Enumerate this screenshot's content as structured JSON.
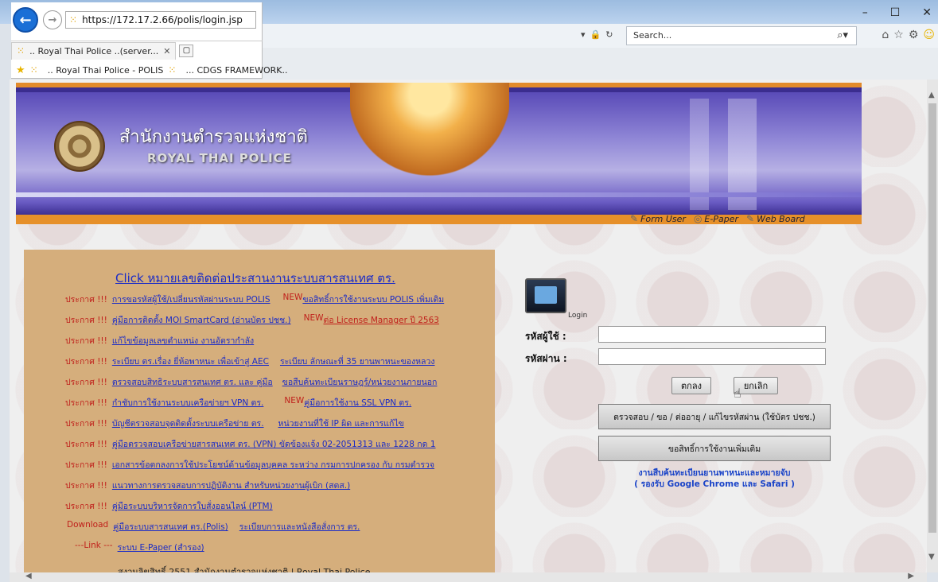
{
  "browser": {
    "search_placeholder": "Search...",
    "window_controls": [
      "–",
      "☐",
      "✕"
    ],
    "url": "https://172.17.2.66/polis/login.jsp",
    "tab_title": ".. Royal Thai Police ..(server...",
    "favorites": [
      ".. Royal Thai Police - POLIS",
      "... CDGS FRAMEWORK.."
    ]
  },
  "banner": {
    "title_th": "สำนักงานตำรวจแห่งชาติ",
    "title_en": "ROYAL THAI POLICE",
    "links": [
      "Form User",
      "E-Paper",
      "Web Board"
    ]
  },
  "announce": {
    "heading": "Click หมายเลขติดต่อประสานงานระบบสารสนเทศ ตร.",
    "rows": [
      {
        "pre": "ประกาศ !!!",
        "link": "การขอรหัสผู้ใช้/เปลี่ยนรหัสผ่านระบบ POLIS",
        "new": "NEW",
        "link2": "ขอสิทธิ์การใช้งานระบบ POLIS เพิ่มเติม"
      },
      {
        "pre": "ประกาศ !!!",
        "link": "คู่มือการติดตั้ง MOI SmartCard (อ่านบัตร ปชช.)",
        "new": "NEW",
        "link2": "ต่อ License Manager ปี 2563"
      },
      {
        "pre": "ประกาศ !!!",
        "link": "แก้ไขข้อมูลเลขตำแหน่ง งานอัตรากำลัง",
        "new": "",
        "link2": ""
      },
      {
        "pre": "ประกาศ !!!",
        "link": "ระเบียบ ตร.เรื่อง ยี่ห้อพาหนะ เพื่อเข้าสู่ AEC",
        "new": "",
        "link2": "ระเบียบ ลักษณะที่ 35 ยานพาหนะของหลวง"
      },
      {
        "pre": "ประกาศ !!!",
        "link": "ตรวจสอบสิทธิระบบสารสนเทศ ตร. และ คู่มือ",
        "new": "",
        "link2": "ขอสืบค้นทะเบียนราษฎร์/หน่วยงานภายนอก"
      },
      {
        "pre": "ประกาศ !!!",
        "link": "กำชับการใช้งานระบบเครือข่ายฯ VPN ตร.",
        "new": "NEW",
        "link2": "คู่มือการใช้งาน SSL VPN ตร."
      },
      {
        "pre": "ประกาศ !!!",
        "link": "บัญชีตรวจสอบจุดติดตั้งระบบเครือข่าย ตร.",
        "new": "",
        "link2": "หน่วยงานที่ใช้ IP ผิด และการแก้ไข"
      },
      {
        "pre": "ประกาศ !!!",
        "link": "คู่มือตรวจสอบเครือข่ายสารสนเทศ ตร. (VPN) ขัดข้องแจ้ง 02-2051313 และ 1228 กด 1",
        "new": "",
        "link2": ""
      },
      {
        "pre": "ประกาศ !!!",
        "link": "เอกสารข้อตกลงการใช้ประโยชน์ด้านข้อมูลบุคคล ระหว่าง กรมการปกครอง กับ กรมตำรวจ",
        "new": "",
        "link2": ""
      },
      {
        "pre": "ประกาศ !!!",
        "link": "แนวทางการตรวจสอบการปฏิบัติงาน สำหรับหน่วยงานผู้เบิก (สตส.)",
        "new": "",
        "link2": ""
      },
      {
        "pre": "ประกาศ !!!",
        "link": "คู่มือระบบบริหารจัดการใบสั่งออนไลน์ (PTM)",
        "new": "",
        "link2": ""
      },
      {
        "pre": "Download",
        "link": "คู่มือระบบสารสนเทศ ตร.(Polis)",
        "new": "",
        "link2": "ระเบียบการและหนังสือสั่งการ ตร."
      },
      {
        "pre": "---Link ---",
        "link": "ระบบ E-Paper (สำรอง)",
        "new": "",
        "link2": ""
      }
    ],
    "copyright": "สงวนลิขสิทธิ์ 2551 สำนักงานตำรวจแห่งชาติ | Royal Thai Police"
  },
  "login": {
    "icon_label": "Login",
    "username_label": "รหัสผู้ใช้ :",
    "username_value": "",
    "password_label": "รหัสผ่าน :",
    "password_value": "",
    "ok_button": "ตกลง",
    "cancel_button": "ยกเลิก",
    "check_button": "ตรวจสอบ / ขอ / ต่ออายุ / แก้ไขรหัสผ่าน (ใช้บัตร ปชช.)",
    "request_button": "ขอสิทธิ์การใช้งานเพิ่มเติม",
    "note_line1": "งานสืบค้นทะเบียนยานพาหนะและหมายจับ",
    "note_line2": "( รองรับ Google Chrome และ Safari )"
  }
}
